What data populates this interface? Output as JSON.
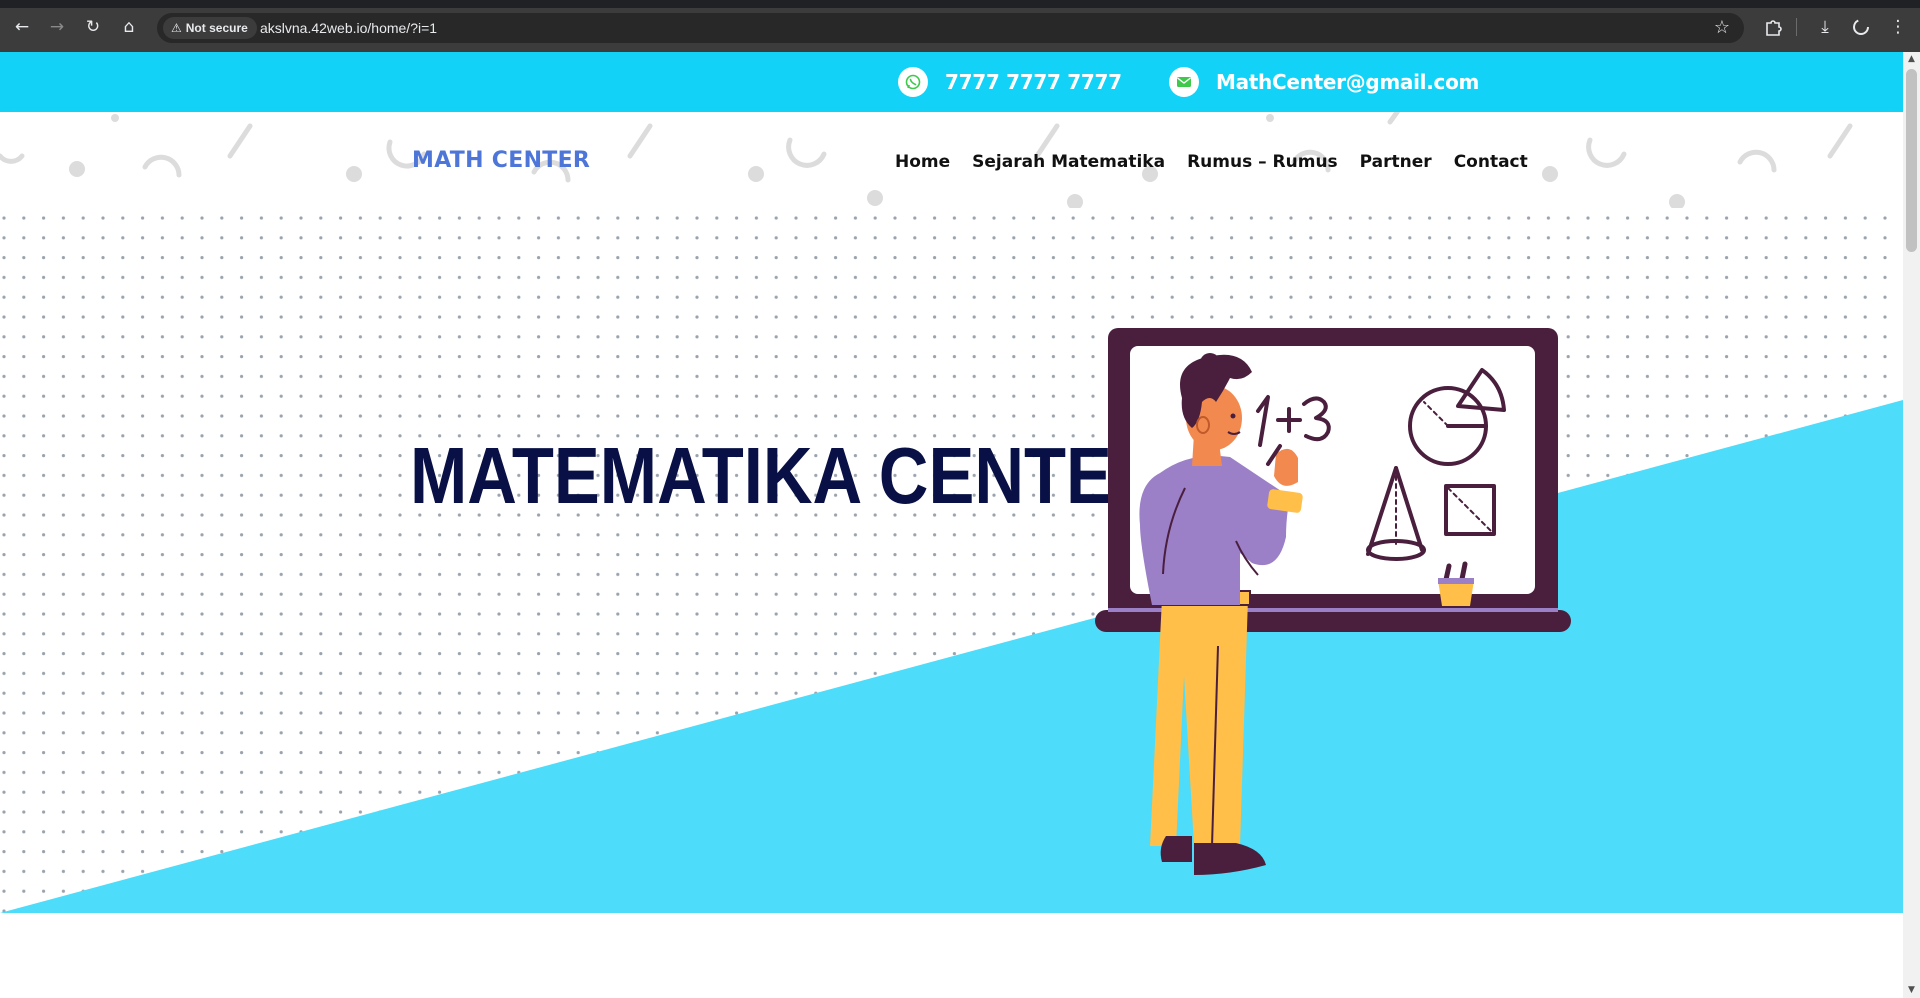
{
  "browser": {
    "security_label": "Not secure",
    "url": "akslvna.42web.io/home/?i=1"
  },
  "contact": {
    "phone": "7777 7777 7777",
    "email": "MathCenter@gmail.com"
  },
  "header": {
    "logo": "MATH CENTER",
    "nav": [
      "Home",
      "Sejarah Matematika",
      "Rumus – Rumus",
      "Partner",
      "Contact"
    ]
  },
  "hero": {
    "title": "MATEMATIKA CENTER",
    "board_equation": "1+3"
  },
  "colors": {
    "contact_bar": "#12d3f7",
    "hero_accent": "#4ddcf9",
    "logo": "#4d76d8",
    "title": "#081045",
    "board_frame": "#4a1f3d",
    "shirt": "#9b7fc7",
    "pants": "#ffbf48",
    "whatsapp_icon": "#3ec94c"
  },
  "icons": [
    "back-icon",
    "forward-icon",
    "reload-icon",
    "home-icon",
    "warning-icon",
    "star-icon",
    "extensions-icon",
    "download-icon",
    "profile-icon",
    "menu-icon",
    "whatsapp-icon",
    "mail-icon"
  ]
}
